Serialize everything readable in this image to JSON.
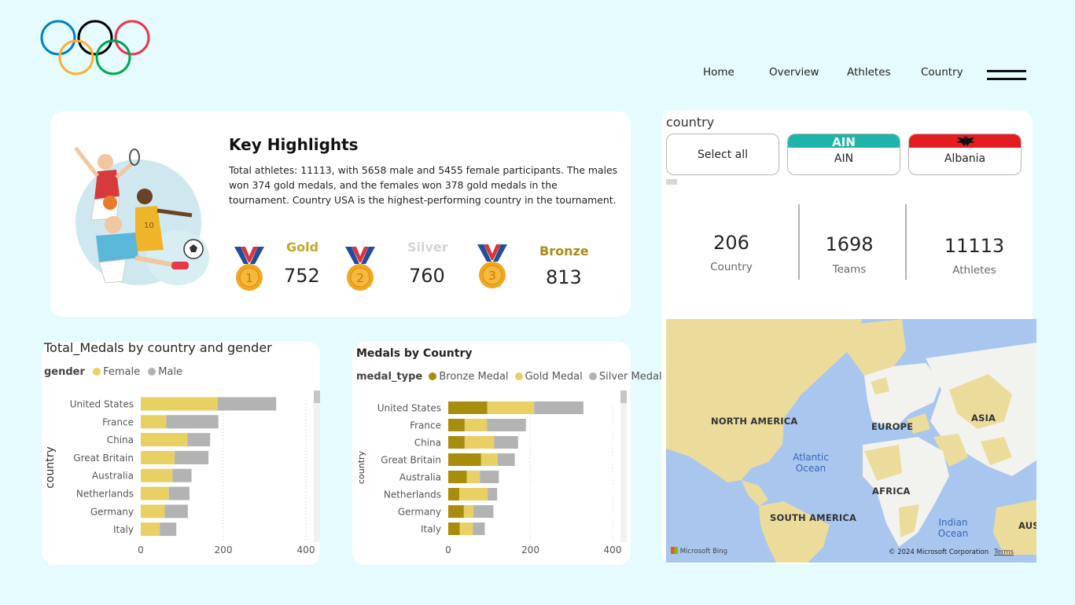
{
  "nav": {
    "items": [
      "Home",
      "Overview",
      "Athletes",
      "Country"
    ]
  },
  "highlights": {
    "title": "Key Highlights",
    "text": "Total athletes: 11113, with 5658 male and 5455 female participants. The males won 374 gold medals, and the females won 378 gold medals in the tournament. Country USA is the highest-performing country in the tournament.",
    "medals": [
      {
        "label": "Gold",
        "value": "752",
        "number": "1",
        "color": "#c8a521"
      },
      {
        "label": "Silver",
        "value": "760",
        "number": "2",
        "color": "#d5d5d5"
      },
      {
        "label": "Bronze",
        "value": "813",
        "number": "3",
        "color": "#a88c16"
      }
    ]
  },
  "slicer": {
    "title": "country",
    "tiles": [
      {
        "label": "Select all"
      },
      {
        "label": "AIN",
        "banner_text": "AIN",
        "banner_color": "#1eb4a8"
      },
      {
        "label": "Albania",
        "banner_color": "#e41e20"
      }
    ]
  },
  "kpis": [
    {
      "value": "206",
      "label": "Country"
    },
    {
      "value": "1698",
      "label": "Teams"
    },
    {
      "value": "11113",
      "label": "Athletes"
    }
  ],
  "chart_data": [
    {
      "type": "bar",
      "orientation": "horizontal",
      "stacked": true,
      "title": "Total_Medals by country and gender",
      "legend_title": "gender",
      "ylabel": "country",
      "categories": [
        "United States",
        "France",
        "China",
        "Great Britain",
        "Australia",
        "Netherlands",
        "Germany",
        "Italy"
      ],
      "series": [
        {
          "name": "Female",
          "color": "#e8d064",
          "values": [
            186,
            62,
            113,
            82,
            77,
            68,
            58,
            46
          ]
        },
        {
          "name": "Male",
          "color": "#b3b3b3",
          "values": [
            142,
            126,
            55,
            82,
            46,
            50,
            56,
            40
          ]
        }
      ],
      "xlim": [
        0,
        400
      ],
      "xticks": [
        0,
        200,
        400
      ],
      "legend_position": "top-left",
      "grid": true
    },
    {
      "type": "bar",
      "orientation": "horizontal",
      "stacked": true,
      "title": "Medals by Country",
      "legend_title": "medal_type",
      "ylabel": "country",
      "categories": [
        "United States",
        "France",
        "China",
        "Great Britain",
        "Australia",
        "Netherlands",
        "Germany",
        "Italy"
      ],
      "series": [
        {
          "name": "Bronze Medal",
          "color": "#a88c0c",
          "values": [
            95,
            40,
            40,
            80,
            45,
            27,
            38,
            28
          ]
        },
        {
          "name": "Gold Medal",
          "color": "#e8d064",
          "values": [
            114,
            54,
            72,
            40,
            32,
            69,
            23,
            32
          ]
        },
        {
          "name": "Silver Medal",
          "color": "#b3b3b3",
          "values": [
            120,
            95,
            58,
            42,
            46,
            23,
            49,
            29
          ]
        }
      ],
      "xlim": [
        0,
        400
      ],
      "xticks": [
        0,
        200,
        400
      ],
      "legend_position": "top-left",
      "grid": true
    }
  ],
  "map": {
    "labels": [
      "NORTH AMERICA",
      "EUROPE",
      "ASIA",
      "AFRICA",
      "SOUTH AMERICA",
      "AUSTR"
    ],
    "oceans": [
      "Atlantic Ocean",
      "Indian Ocean"
    ],
    "attribution": "Microsoft Bing",
    "copyright": "© 2024 Microsoft Corporation",
    "terms": "Terms",
    "land_highlight": "#ecdc9c",
    "land_plain": "#f2f2ef",
    "water": "#a9c6ee"
  }
}
